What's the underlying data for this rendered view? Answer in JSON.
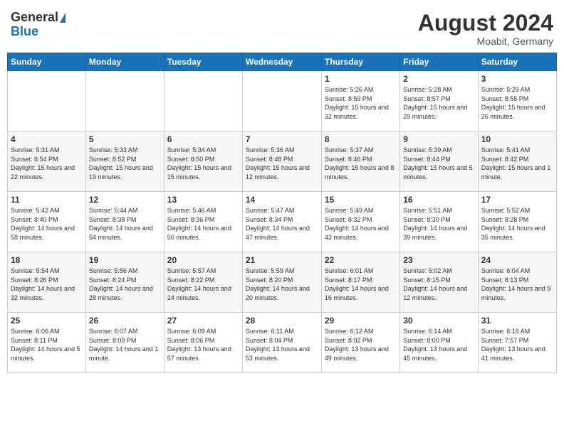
{
  "header": {
    "logo_general": "General",
    "logo_blue": "Blue",
    "month_title": "August 2024",
    "location": "Moabit, Germany"
  },
  "days_of_week": [
    "Sunday",
    "Monday",
    "Tuesday",
    "Wednesday",
    "Thursday",
    "Friday",
    "Saturday"
  ],
  "weeks": [
    [
      {
        "day": "",
        "sunrise": "",
        "sunset": "",
        "daylight": ""
      },
      {
        "day": "",
        "sunrise": "",
        "sunset": "",
        "daylight": ""
      },
      {
        "day": "",
        "sunrise": "",
        "sunset": "",
        "daylight": ""
      },
      {
        "day": "",
        "sunrise": "",
        "sunset": "",
        "daylight": ""
      },
      {
        "day": "1",
        "sunrise": "Sunrise: 5:26 AM",
        "sunset": "Sunset: 8:59 PM",
        "daylight": "Daylight: 15 hours and 32 minutes."
      },
      {
        "day": "2",
        "sunrise": "Sunrise: 5:28 AM",
        "sunset": "Sunset: 8:57 PM",
        "daylight": "Daylight: 15 hours and 29 minutes."
      },
      {
        "day": "3",
        "sunrise": "Sunrise: 5:29 AM",
        "sunset": "Sunset: 8:55 PM",
        "daylight": "Daylight: 15 hours and 26 minutes."
      }
    ],
    [
      {
        "day": "4",
        "sunrise": "Sunrise: 5:31 AM",
        "sunset": "Sunset: 8:54 PM",
        "daylight": "Daylight: 15 hours and 22 minutes."
      },
      {
        "day": "5",
        "sunrise": "Sunrise: 5:33 AM",
        "sunset": "Sunset: 8:52 PM",
        "daylight": "Daylight: 15 hours and 19 minutes."
      },
      {
        "day": "6",
        "sunrise": "Sunrise: 5:34 AM",
        "sunset": "Sunset: 8:50 PM",
        "daylight": "Daylight: 15 hours and 15 minutes."
      },
      {
        "day": "7",
        "sunrise": "Sunrise: 5:36 AM",
        "sunset": "Sunset: 8:48 PM",
        "daylight": "Daylight: 15 hours and 12 minutes."
      },
      {
        "day": "8",
        "sunrise": "Sunrise: 5:37 AM",
        "sunset": "Sunset: 8:46 PM",
        "daylight": "Daylight: 15 hours and 8 minutes."
      },
      {
        "day": "9",
        "sunrise": "Sunrise: 5:39 AM",
        "sunset": "Sunset: 8:44 PM",
        "daylight": "Daylight: 15 hours and 5 minutes."
      },
      {
        "day": "10",
        "sunrise": "Sunrise: 5:41 AM",
        "sunset": "Sunset: 8:42 PM",
        "daylight": "Daylight: 15 hours and 1 minute."
      }
    ],
    [
      {
        "day": "11",
        "sunrise": "Sunrise: 5:42 AM",
        "sunset": "Sunset: 8:40 PM",
        "daylight": "Daylight: 14 hours and 58 minutes."
      },
      {
        "day": "12",
        "sunrise": "Sunrise: 5:44 AM",
        "sunset": "Sunset: 8:38 PM",
        "daylight": "Daylight: 14 hours and 54 minutes."
      },
      {
        "day": "13",
        "sunrise": "Sunrise: 5:46 AM",
        "sunset": "Sunset: 8:36 PM",
        "daylight": "Daylight: 14 hours and 50 minutes."
      },
      {
        "day": "14",
        "sunrise": "Sunrise: 5:47 AM",
        "sunset": "Sunset: 8:34 PM",
        "daylight": "Daylight: 14 hours and 47 minutes."
      },
      {
        "day": "15",
        "sunrise": "Sunrise: 5:49 AM",
        "sunset": "Sunset: 8:32 PM",
        "daylight": "Daylight: 14 hours and 43 minutes."
      },
      {
        "day": "16",
        "sunrise": "Sunrise: 5:51 AM",
        "sunset": "Sunset: 8:30 PM",
        "daylight": "Daylight: 14 hours and 39 minutes."
      },
      {
        "day": "17",
        "sunrise": "Sunrise: 5:52 AM",
        "sunset": "Sunset: 8:28 PM",
        "daylight": "Daylight: 14 hours and 35 minutes."
      }
    ],
    [
      {
        "day": "18",
        "sunrise": "Sunrise: 5:54 AM",
        "sunset": "Sunset: 8:26 PM",
        "daylight": "Daylight: 14 hours and 32 minutes."
      },
      {
        "day": "19",
        "sunrise": "Sunrise: 5:56 AM",
        "sunset": "Sunset: 8:24 PM",
        "daylight": "Daylight: 14 hours and 28 minutes."
      },
      {
        "day": "20",
        "sunrise": "Sunrise: 5:57 AM",
        "sunset": "Sunset: 8:22 PM",
        "daylight": "Daylight: 14 hours and 24 minutes."
      },
      {
        "day": "21",
        "sunrise": "Sunrise: 5:59 AM",
        "sunset": "Sunset: 8:20 PM",
        "daylight": "Daylight: 14 hours and 20 minutes."
      },
      {
        "day": "22",
        "sunrise": "Sunrise: 6:01 AM",
        "sunset": "Sunset: 8:17 PM",
        "daylight": "Daylight: 14 hours and 16 minutes."
      },
      {
        "day": "23",
        "sunrise": "Sunrise: 6:02 AM",
        "sunset": "Sunset: 8:15 PM",
        "daylight": "Daylight: 14 hours and 12 minutes."
      },
      {
        "day": "24",
        "sunrise": "Sunrise: 6:04 AM",
        "sunset": "Sunset: 8:13 PM",
        "daylight": "Daylight: 14 hours and 9 minutes."
      }
    ],
    [
      {
        "day": "25",
        "sunrise": "Sunrise: 6:06 AM",
        "sunset": "Sunset: 8:11 PM",
        "daylight": "Daylight: 14 hours and 5 minutes."
      },
      {
        "day": "26",
        "sunrise": "Sunrise: 6:07 AM",
        "sunset": "Sunset: 8:09 PM",
        "daylight": "Daylight: 14 hours and 1 minute."
      },
      {
        "day": "27",
        "sunrise": "Sunrise: 6:09 AM",
        "sunset": "Sunset: 8:06 PM",
        "daylight": "Daylight: 13 hours and 57 minutes."
      },
      {
        "day": "28",
        "sunrise": "Sunrise: 6:11 AM",
        "sunset": "Sunset: 8:04 PM",
        "daylight": "Daylight: 13 hours and 53 minutes."
      },
      {
        "day": "29",
        "sunrise": "Sunrise: 6:12 AM",
        "sunset": "Sunset: 8:02 PM",
        "daylight": "Daylight: 13 hours and 49 minutes."
      },
      {
        "day": "30",
        "sunrise": "Sunrise: 6:14 AM",
        "sunset": "Sunset: 8:00 PM",
        "daylight": "Daylight: 13 hours and 45 minutes."
      },
      {
        "day": "31",
        "sunrise": "Sunrise: 6:16 AM",
        "sunset": "Sunset: 7:57 PM",
        "daylight": "Daylight: 13 hours and 41 minutes."
      }
    ]
  ]
}
